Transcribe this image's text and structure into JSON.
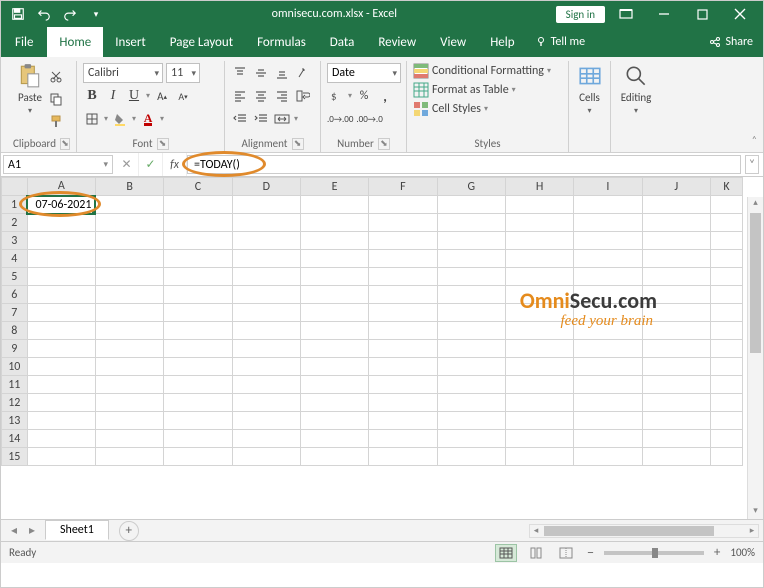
{
  "title": "omnisecu.com.xlsx - Excel",
  "signin": "Sign in",
  "tabs": {
    "file": "File",
    "home": "Home",
    "insert": "Insert",
    "page_layout": "Page Layout",
    "formulas": "Formulas",
    "data": "Data",
    "review": "Review",
    "view": "View",
    "help": "Help",
    "tellme": "Tell me",
    "share": "Share"
  },
  "ribbon": {
    "clipboard": {
      "paste": "Paste",
      "label": "Clipboard"
    },
    "font": {
      "name": "Calibri",
      "size": "11",
      "label": "Font"
    },
    "alignment": {
      "label": "Alignment"
    },
    "number": {
      "format": "Date",
      "label": "Number"
    },
    "styles": {
      "cond": "Conditional Formatting",
      "table": "Format as Table",
      "cell": "Cell Styles",
      "label": "Styles"
    },
    "cells": {
      "label": "Cells"
    },
    "editing": {
      "label": "Editing"
    }
  },
  "namebox": "A1",
  "formula": "=TODAY()",
  "columns": [
    "A",
    "B",
    "C",
    "D",
    "E",
    "F",
    "G",
    "H",
    "I",
    "J",
    "K"
  ],
  "rows": [
    1,
    2,
    3,
    4,
    5,
    6,
    7,
    8,
    9,
    10,
    11,
    12,
    13,
    14,
    15
  ],
  "a1_value": "07-06-2021",
  "sheet_tab": "Sheet1",
  "status": {
    "ready": "Ready",
    "zoom": "100%"
  },
  "watermark": {
    "brand_pre": "Omni",
    "brand_post": "Secu",
    "brand_suffix": ".com",
    "tag": "feed your brain"
  }
}
